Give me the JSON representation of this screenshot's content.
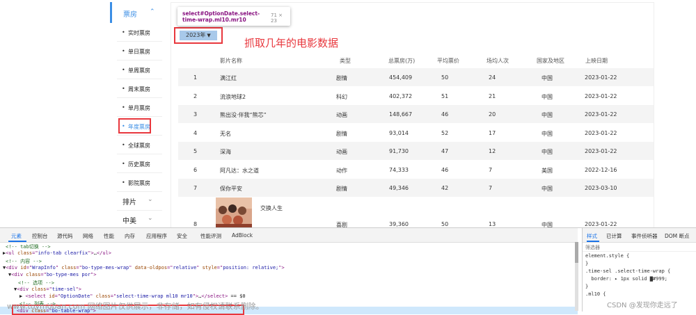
{
  "sidebar": {
    "header": {
      "label": "票房",
      "chevron": "chevron-up-icon"
    },
    "items": [
      {
        "label": "实时票房"
      },
      {
        "label": "单日票房"
      },
      {
        "label": "单周票房"
      },
      {
        "label": "周末票房"
      },
      {
        "label": "单月票房"
      },
      {
        "label": "年度票房",
        "active": true
      },
      {
        "label": "全球票房"
      },
      {
        "label": "历史票房"
      },
      {
        "label": "影院票房"
      }
    ],
    "sections": [
      {
        "label": "排片",
        "chevron": "chevron-down-icon"
      },
      {
        "label": "中美",
        "chevron": "chevron-down-icon"
      }
    ],
    "bullet": "•"
  },
  "tooltip": {
    "selector": "select#OptionDate.select-time-wrap.ml10.mr10",
    "dimensions": "71 × 23"
  },
  "year_select": {
    "value": "2023年",
    "arrow": "chevron-down-icon"
  },
  "annotation": "抓取几年的电影数据",
  "table": {
    "headers": [
      "影片名称",
      "类型",
      "总票房(万)",
      "平均票价",
      "场均人次",
      "国家及地区",
      "上映日期"
    ],
    "rows": [
      {
        "rank": "1",
        "name": "满江红",
        "genre": "剧情",
        "box": "454,409",
        "price": "50",
        "avg": "24",
        "region": "中国",
        "date": "2023-01-22"
      },
      {
        "rank": "2",
        "name": "流浪地球2",
        "genre": "科幻",
        "box": "402,372",
        "price": "51",
        "avg": "21",
        "region": "中国",
        "date": "2023-01-22"
      },
      {
        "rank": "3",
        "name": "熊出没·伴我“熊芯”",
        "genre": "动画",
        "box": "148,667",
        "price": "46",
        "avg": "20",
        "region": "中国",
        "date": "2023-01-22"
      },
      {
        "rank": "4",
        "name": "无名",
        "genre": "剧情",
        "box": "93,014",
        "price": "52",
        "avg": "17",
        "region": "中国",
        "date": "2023-01-22"
      },
      {
        "rank": "5",
        "name": "深海",
        "genre": "动画",
        "box": "91,730",
        "price": "47",
        "avg": "12",
        "region": "中国",
        "date": "2023-01-22"
      },
      {
        "rank": "6",
        "name": "阿凡达：水之道",
        "genre": "动作",
        "box": "74,333",
        "price": "46",
        "avg": "7",
        "region": "美国",
        "date": "2022-12-16"
      },
      {
        "rank": "7",
        "name": "保你平安",
        "genre": "剧情",
        "box": "49,346",
        "price": "42",
        "avg": "7",
        "region": "中国",
        "date": "2023-03-10"
      },
      {
        "rank": "8",
        "name": "交换人生",
        "genre": "喜剧",
        "box": "39,360",
        "price": "50",
        "avg": "13",
        "region": "中国",
        "date": "2023-01-22"
      }
    ]
  },
  "devtools": {
    "tabs": [
      "元素",
      "控制台",
      "源代码",
      "网络",
      "性能",
      "内存",
      "应用程序",
      "安全",
      "性能评测",
      "AdBlock"
    ],
    "active_tab": "元素",
    "lines": [
      {
        "indent": 8,
        "parts": [
          [
            "cmt",
            "<!-- tab切换 -->"
          ]
        ]
      },
      {
        "indent": 4,
        "parts": [
          [
            "txt",
            "▶"
          ],
          [
            "tag",
            "<ul "
          ],
          [
            "attr",
            "class"
          ],
          [
            "tag",
            "=\""
          ],
          [
            "val",
            "info-tab clearfix"
          ],
          [
            "tag",
            "\">"
          ],
          [
            "txt",
            "…"
          ],
          [
            "tag",
            "</ul>"
          ]
        ]
      },
      {
        "indent": 8,
        "parts": [
          [
            "cmt",
            "<!-- 内容 -->"
          ]
        ]
      },
      {
        "indent": 4,
        "parts": [
          [
            "txt",
            "▼"
          ],
          [
            "tag",
            "<div "
          ],
          [
            "attr",
            "id"
          ],
          [
            "tag",
            "=\""
          ],
          [
            "val",
            "WrapInfo"
          ],
          [
            "tag",
            "\" "
          ],
          [
            "attr",
            "class"
          ],
          [
            "tag",
            "=\""
          ],
          [
            "val",
            "bo-type-mes-wrap"
          ],
          [
            "tag",
            "\" "
          ],
          [
            "attr",
            "data-oldpos"
          ],
          [
            "tag",
            "=\""
          ],
          [
            "val",
            "relative"
          ],
          [
            "tag",
            "\" "
          ],
          [
            "attr",
            "style"
          ],
          [
            "tag",
            "=\""
          ],
          [
            "val",
            "position: relative;"
          ],
          [
            "tag",
            "\">"
          ]
        ]
      },
      {
        "indent": 12,
        "parts": [
          [
            "txt",
            "▼"
          ],
          [
            "tag",
            "<div "
          ],
          [
            "attr",
            "class"
          ],
          [
            "tag",
            "=\""
          ],
          [
            "val",
            "bo-type-mes por"
          ],
          [
            "tag",
            "\">"
          ]
        ]
      },
      {
        "indent": 26,
        "parts": [
          [
            "cmt",
            "<!-- 选项 -->"
          ]
        ]
      },
      {
        "indent": 20,
        "parts": [
          [
            "txt",
            "▼"
          ],
          [
            "tag",
            "<div "
          ],
          [
            "attr",
            "class"
          ],
          [
            "tag",
            "=\""
          ],
          [
            "val",
            "time-sel"
          ],
          [
            "tag",
            "\">"
          ]
        ]
      },
      {
        "indent": 28,
        "parts": [
          [
            "txt",
            "▶ "
          ],
          [
            "tag",
            "<select "
          ],
          [
            "attr",
            "id"
          ],
          [
            "tag",
            "=\""
          ],
          [
            "val",
            "OptionDate"
          ],
          [
            "tag",
            "\" "
          ],
          [
            "attr",
            "class"
          ],
          [
            "tag",
            "=\""
          ],
          [
            "val",
            "select-time-wrap ml10 mr10"
          ],
          [
            "tag",
            "\">"
          ],
          [
            "txt",
            "…"
          ],
          [
            "tag",
            "</select>"
          ],
          [
            "txt",
            " == $0"
          ]
        ]
      },
      {
        "indent": 28,
        "parts": [
          [
            "cmt",
            "<!-- 列表 -->"
          ]
        ]
      },
      {
        "indent": 24,
        "parts": [
          [
            "tag",
            "<div "
          ],
          [
            "attr",
            "class"
          ],
          [
            "tag",
            "=\""
          ],
          [
            "val",
            "bo-table-wrap"
          ],
          [
            "tag",
            "\">"
          ]
        ]
      }
    ]
  },
  "styles_pane": {
    "tabs": [
      "样式",
      "已计算",
      "事件侦听器",
      "DOM 断点"
    ],
    "active_tab": "样式",
    "filter_placeholder": "筛选器",
    "lines": [
      "element.style {",
      "}",
      ".time-sel .select-time-wrap {",
      "  border: ▸ 1px solid ▇#999;",
      "}",
      ".ml10 {"
    ]
  },
  "watermark": "www.toymoban.com 网络图片仅供展示，非存储，如有侵权请联系删除。",
  "csdn": "CSDN @发现你走远了",
  "colors": {
    "accent": "#3b8ee5",
    "annotation_red": "#e8373d",
    "select_bg": "#a8c9ea"
  }
}
